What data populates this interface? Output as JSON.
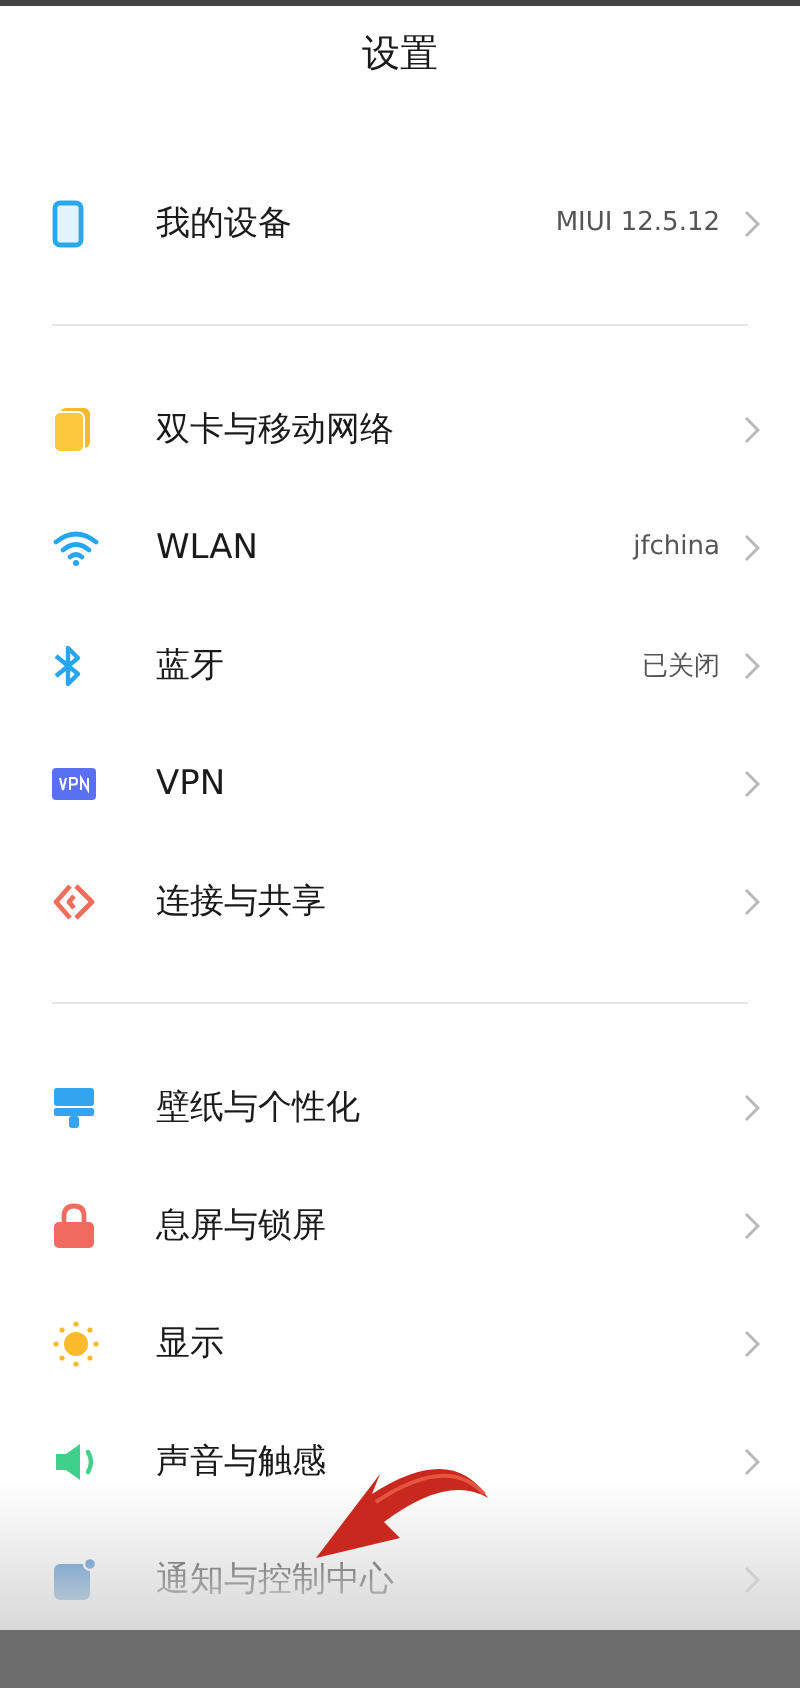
{
  "header": {
    "title": "设置"
  },
  "groups": [
    {
      "rows": [
        {
          "label": "我的设备",
          "value": "MIUI 12.5.12"
        }
      ]
    },
    {
      "rows": [
        {
          "label": "双卡与移动网络"
        },
        {
          "label": "WLAN",
          "value": "jfchina"
        },
        {
          "label": "蓝牙",
          "value": "已关闭"
        },
        {
          "label": "VPN"
        },
        {
          "label": "连接与共享"
        }
      ]
    },
    {
      "rows": [
        {
          "label": "壁纸与个性化"
        },
        {
          "label": "息屏与锁屏"
        },
        {
          "label": "显示"
        },
        {
          "label": "声音与触感"
        },
        {
          "label": "通知与控制中心"
        }
      ]
    }
  ]
}
